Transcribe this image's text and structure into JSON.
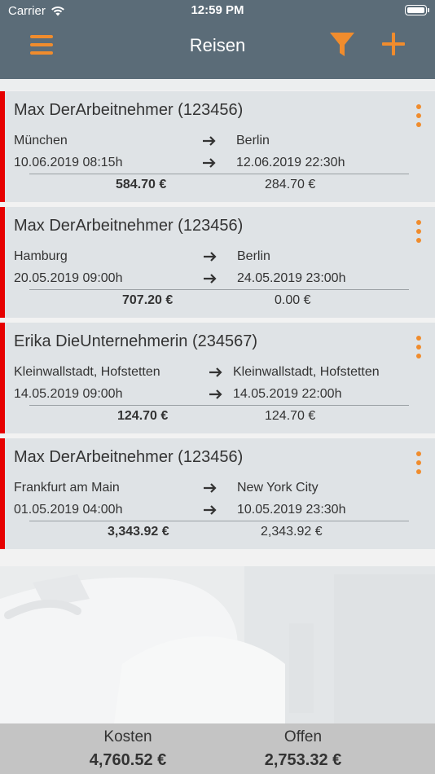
{
  "status_bar": {
    "carrier": "Carrier",
    "time": "12:59 PM"
  },
  "header": {
    "title": "Reisen"
  },
  "trips": [
    {
      "name": "Max DerArbeitnehmer (123456)",
      "from_city": "München",
      "to_city": "Berlin",
      "from_date": "10.06.2019 08:15h",
      "to_date": "12.06.2019 22:30h",
      "cost": "584.70 €",
      "open": "284.70 €"
    },
    {
      "name": "Max DerArbeitnehmer (123456)",
      "from_city": "Hamburg",
      "to_city": "Berlin",
      "from_date": "20.05.2019 09:00h",
      "to_date": "24.05.2019 23:00h",
      "cost": "707.20 €",
      "open": "0.00 €"
    },
    {
      "name": "Erika DieUnternehmerin (234567)",
      "from_city": "Kleinwallstadt, Hofstetten",
      "to_city": "Kleinwallstadt, Hofstetten",
      "from_date": "14.05.2019 09:00h",
      "to_date": "14.05.2019 22:00h",
      "cost": "124.70 €",
      "open": "124.70 €"
    },
    {
      "name": "Max DerArbeitnehmer (123456)",
      "from_city": "Frankfurt am Main",
      "to_city": "New York City",
      "from_date": "01.05.2019 04:00h",
      "to_date": "10.05.2019 23:30h",
      "cost": "3,343.92 €",
      "open": "2,343.92 €"
    }
  ],
  "footer": {
    "cost_label": "Kosten",
    "cost_value": "4,760.52 €",
    "open_label": "Offen",
    "open_value": "2,753.32 €"
  },
  "colors": {
    "header_bg": "#5b6c78",
    "accent": "#f08c2d",
    "status_stripe": "#e60000",
    "card_bg": "#dfe3e6"
  }
}
